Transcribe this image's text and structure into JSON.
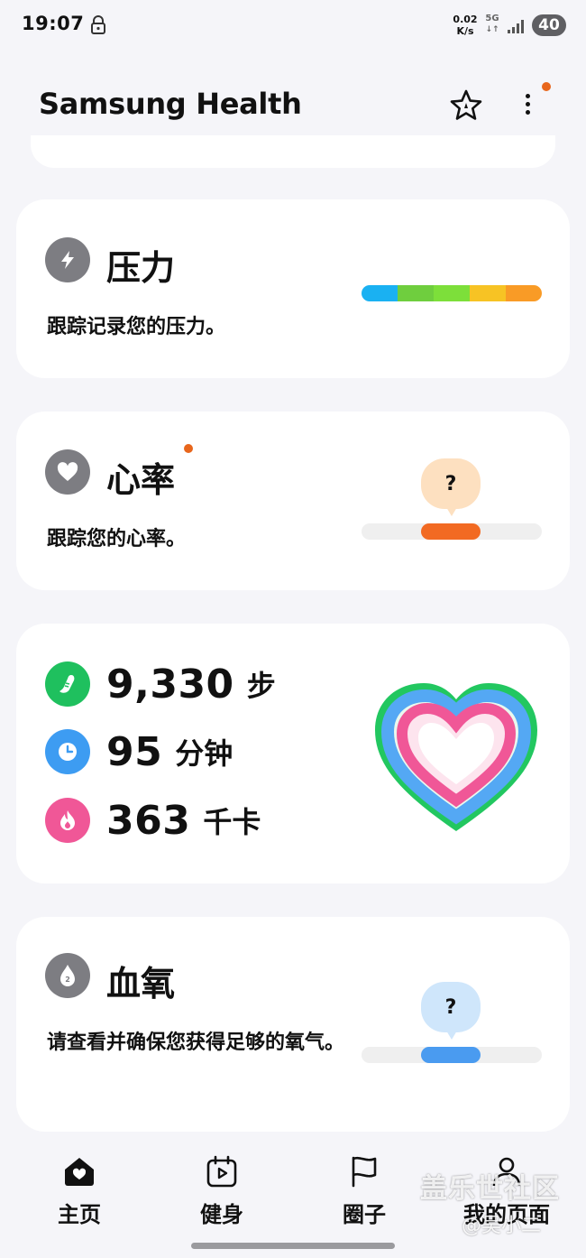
{
  "status_bar": {
    "time": "19:07",
    "speed_value": "0.02",
    "speed_unit": "K/s",
    "network": "5G",
    "battery": "40"
  },
  "header": {
    "title": "Samsung Health"
  },
  "stress": {
    "title": "压力",
    "description": "跟踪记录您的压力。",
    "scale_colors": [
      "#1ab1f2",
      "#6fce3e",
      "#7ddf3a",
      "#f7c324",
      "#f99b26"
    ]
  },
  "heart_rate": {
    "title": "心率",
    "description": "跟踪您的心率。",
    "bubble": "?",
    "accent": "#f26a22"
  },
  "activity": {
    "steps_value": "9,330",
    "steps_unit": "步",
    "minutes_value": "95",
    "minutes_unit": "分钟",
    "calories_value": "363",
    "calories_unit": "千卡",
    "colors": {
      "steps": "#1fc05e",
      "minutes": "#3d9cf2",
      "calories": "#f05797"
    }
  },
  "blood_oxygen": {
    "title": "血氧",
    "description": "请查看并确保您获得足够的氧气。",
    "bubble": "?",
    "accent": "#4a9bf0"
  },
  "bottom_nav": {
    "items": [
      {
        "label": "主页",
        "icon": "home-icon"
      },
      {
        "label": "健身",
        "icon": "fitness-calendar-icon"
      },
      {
        "label": "圈子",
        "icon": "flag-icon"
      },
      {
        "label": "我的页面",
        "icon": "person-icon"
      }
    ]
  },
  "watermark": {
    "line1": "盖乐世社区",
    "line2": "@吴小二"
  }
}
